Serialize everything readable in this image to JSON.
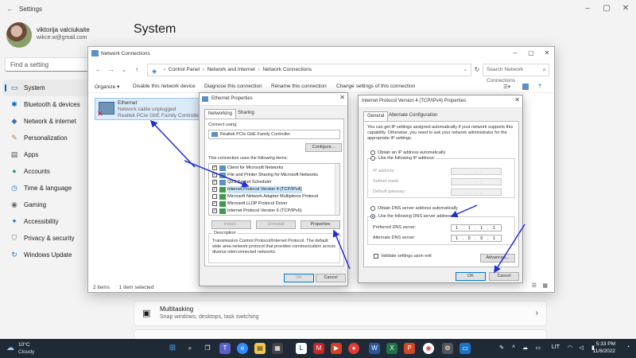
{
  "settings": {
    "window_title": "Settings",
    "user_name": "viktorija valciukaite",
    "user_email": "wikce.w@gmail.com",
    "search_placeholder": "Find a setting",
    "page_title": "System",
    "nav": [
      {
        "label": "System",
        "icon": "system-icon",
        "active": true
      },
      {
        "label": "Bluetooth & devices",
        "icon": "bluetooth-icon"
      },
      {
        "label": "Network & internet",
        "icon": "network-icon"
      },
      {
        "label": "Personalization",
        "icon": "brush-icon"
      },
      {
        "label": "Apps",
        "icon": "apps-icon"
      },
      {
        "label": "Accounts",
        "icon": "person-icon"
      },
      {
        "label": "Time & language",
        "icon": "clock-icon"
      },
      {
        "label": "Gaming",
        "icon": "gamepad-icon"
      },
      {
        "label": "Accessibility",
        "icon": "accessibility-icon"
      },
      {
        "label": "Privacy & security",
        "icon": "shield-icon"
      },
      {
        "label": "Windows Update",
        "icon": "update-icon"
      }
    ],
    "cards": [
      {
        "title": "Multitasking",
        "subtitle": "Snap windows, desktops, task switching",
        "icon": "multitasking-icon"
      }
    ]
  },
  "network_connections": {
    "window_title": "Network Connections",
    "breadcrumb": [
      "Control Panel",
      "Network and Internet",
      "Network Connections"
    ],
    "search_placeholder": "Search Network Connections",
    "toolbar": [
      "Organize ▾",
      "Disable this network device",
      "Diagnose this connection",
      "Rename this connection",
      "Change settings of this connection"
    ],
    "adapter": {
      "name": "Ethernet",
      "status": "Network cable unplugged",
      "device": "Realtek PCIe GbE Family Controller"
    },
    "status_items": "2 items",
    "status_selected": "1 item selected"
  },
  "ethernet_properties": {
    "title": "Ethernet Properties",
    "tabs": [
      "Networking",
      "Sharing"
    ],
    "connect_using_label": "Connect using:",
    "adapter": "Realtek PCIe GbE Family Controller",
    "configure_button": "Configure...",
    "items_label": "This connection uses the following items:",
    "items": [
      {
        "label": "Client for Microsoft Networks",
        "checked": true
      },
      {
        "label": "File and Printer Sharing for Microsoft Networks",
        "checked": true
      },
      {
        "label": "QoS Packet Scheduler",
        "checked": true
      },
      {
        "label": "Internet Protocol Version 4 (TCP/IPv4)",
        "checked": true,
        "selected": true
      },
      {
        "label": "Microsoft Network Adapter Multiplexor Protocol",
        "checked": false
      },
      {
        "label": "Microsoft LLDP Protocol Driver",
        "checked": true
      },
      {
        "label": "Internet Protocol Version 6 (TCP/IPv6)",
        "checked": true
      }
    ],
    "install_button": "Install...",
    "uninstall_button": "Uninstall",
    "properties_button": "Properties",
    "description_label": "Description",
    "description": "Transmission Control Protocol/Internet Protocol. The default wide area network protocol that provides communication across diverse interconnected networks.",
    "ok_button": "OK",
    "cancel_button": "Cancel"
  },
  "ipv4_properties": {
    "title": "Internet Protocol Version 4 (TCP/IPv4) Properties",
    "tabs": [
      "General",
      "Alternate Configuration"
    ],
    "intro": "You can get IP settings assigned automatically if your network supports this capability. Otherwise, you need to ask your network administrator for the appropriate IP settings.",
    "obtain_ip_auto": "Obtain an IP address automatically",
    "use_following_ip": "Use the following IP address:",
    "ip_address_label": "IP address:",
    "subnet_label": "Subnet mask:",
    "gateway_label": "Default gateway:",
    "obtain_dns_auto": "Obtain DNS server address automatically",
    "use_following_dns": "Use the following DNS server addresses:",
    "preferred_dns_label": "Preferred DNS server:",
    "preferred_dns": "1 . 1 . 1 . 1",
    "alternate_dns_label": "Alternate DNS server:",
    "alternate_dns": "1 . 0 . 0 . 1",
    "empty_ip": ". . .",
    "validate_label": "Validate settings upon exit",
    "advanced_button": "Advanced...",
    "ok_button": "OK",
    "cancel_button": "Cancel"
  },
  "taskbar": {
    "temperature": "10°C",
    "weather": "Cloudy",
    "language": "LIT",
    "time": "5:33 PM",
    "date": "11/8/2022"
  },
  "colors": {
    "accent": "#0067c0",
    "annotation_arrow": "#1d2fd6",
    "taskbar": "#1f2a36"
  }
}
